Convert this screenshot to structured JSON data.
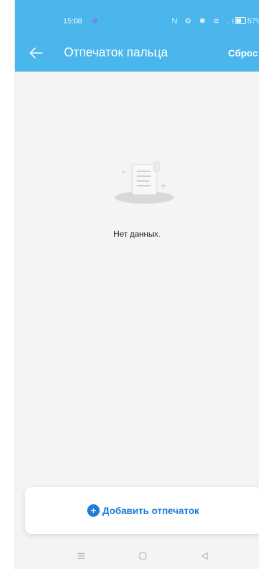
{
  "status_bar": {
    "time": "15:08",
    "icons_text": "N ⚙ ✱ ≋ .ıl",
    "battery_percent": "57%"
  },
  "header": {
    "title": "Отпечаток пальца",
    "reset_label": "Сброс"
  },
  "empty_state": {
    "message": "Нет данных."
  },
  "add_button": {
    "label": "Добавить отпечаток"
  },
  "nav": {
    "items": [
      "menu-icon",
      "home-icon",
      "back-triangle-icon"
    ]
  },
  "colors": {
    "header_bg": "#4ab6ec",
    "accent": "#1f7dd8",
    "page_bg": "#f4f4f4"
  }
}
